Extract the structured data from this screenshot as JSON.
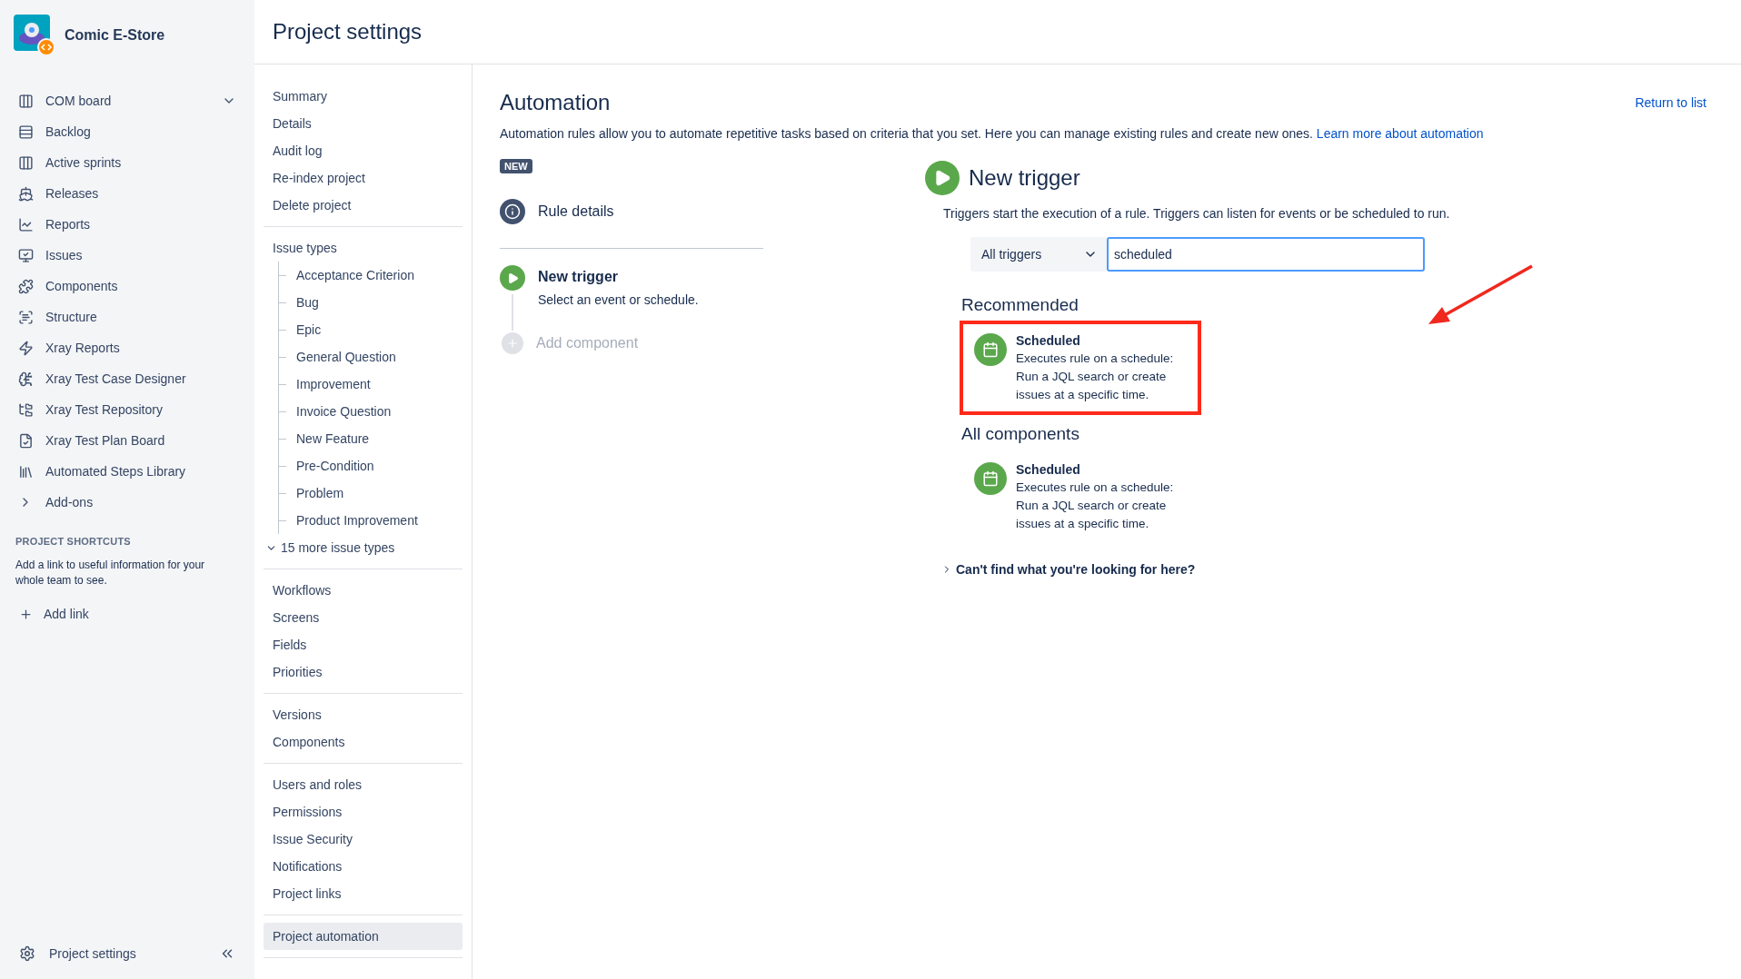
{
  "sidebar": {
    "project_name": "Comic E-Store",
    "items": [
      {
        "label": "COM board",
        "kind": "dropdown"
      },
      {
        "label": "Backlog",
        "kind": "link"
      },
      {
        "label": "Active sprints",
        "kind": "link"
      },
      {
        "label": "Releases",
        "kind": "link"
      },
      {
        "label": "Reports",
        "kind": "link"
      },
      {
        "label": "Issues",
        "kind": "link"
      },
      {
        "label": "Components",
        "kind": "link"
      },
      {
        "label": "Structure",
        "kind": "link"
      },
      {
        "label": "Xray Reports",
        "kind": "link"
      },
      {
        "label": "Xray Test Case Designer",
        "kind": "link"
      },
      {
        "label": "Xray Test Repository",
        "kind": "link"
      },
      {
        "label": "Xray Test Plan Board",
        "kind": "link"
      },
      {
        "label": "Automated Steps Library",
        "kind": "link"
      },
      {
        "label": "Add-ons",
        "kind": "collapsed"
      }
    ],
    "shortcuts": {
      "heading": "PROJECT SHORTCUTS",
      "text": "Add a link to useful information for your whole team to see.",
      "add_label": "Add link"
    },
    "footer": {
      "label": "Project settings"
    }
  },
  "header": {
    "title": "Project settings"
  },
  "settings_nav": {
    "sections": [
      {
        "kind": "links",
        "items": [
          {
            "label": "Summary",
            "selected": false
          },
          {
            "label": "Details",
            "selected": false
          },
          {
            "label": "Audit log",
            "selected": false
          },
          {
            "label": "Re-index project",
            "selected": false
          },
          {
            "label": "Delete project",
            "selected": false
          }
        ]
      },
      {
        "kind": "tree",
        "heading": "Issue types",
        "items": [
          {
            "label": "Acceptance Criterion",
            "selected": false
          },
          {
            "label": "Bug",
            "selected": false
          },
          {
            "label": "Epic",
            "selected": false
          },
          {
            "label": "General Question",
            "selected": false
          },
          {
            "label": "Improvement",
            "selected": false
          },
          {
            "label": "Invoice Question",
            "selected": false
          },
          {
            "label": "New Feature",
            "selected": false
          },
          {
            "label": "Pre-Condition",
            "selected": false
          },
          {
            "label": "Problem",
            "selected": false
          },
          {
            "label": "Product Improvement",
            "selected": false
          }
        ],
        "more": "15 more issue types"
      },
      {
        "kind": "links",
        "items": [
          {
            "label": "Workflows",
            "selected": false
          },
          {
            "label": "Screens",
            "selected": false
          },
          {
            "label": "Fields",
            "selected": false
          },
          {
            "label": "Priorities",
            "selected": false
          }
        ]
      },
      {
        "kind": "links",
        "items": [
          {
            "label": "Versions",
            "selected": false
          },
          {
            "label": "Components",
            "selected": false
          }
        ]
      },
      {
        "kind": "links",
        "items": [
          {
            "label": "Users and roles",
            "selected": false
          },
          {
            "label": "Permissions",
            "selected": false
          },
          {
            "label": "Issue Security",
            "selected": false
          },
          {
            "label": "Notifications",
            "selected": false
          },
          {
            "label": "Project links",
            "selected": false
          }
        ]
      },
      {
        "kind": "links",
        "items": [
          {
            "label": "Project automation",
            "selected": true
          }
        ]
      }
    ]
  },
  "automation": {
    "title": "Automation",
    "return_link": "Return to list",
    "description": "Automation rules allow you to automate repetitive tasks based on criteria that you set. Here you can manage existing rules and create new ones.",
    "learn_more_link": "Learn more about automation",
    "badge": "NEW",
    "steps": [
      {
        "kind": "details",
        "title": "Rule details"
      },
      {
        "kind": "trigger",
        "title": "New trigger",
        "subtitle": "Select an event or schedule."
      },
      {
        "kind": "add",
        "title": "Add component"
      }
    ],
    "trigger_panel": {
      "title": "New trigger",
      "description": "Triggers start the execution of a rule. Triggers can listen for events or be scheduled to run.",
      "filter": {
        "value": "All triggers"
      },
      "search": {
        "value": "scheduled",
        "focused": true
      },
      "sections": [
        {
          "heading": "Recommended",
          "items": [
            {
              "title": "Scheduled",
              "description": "Executes rule on a schedule: Run a JQL search or create issues at a specific time.",
              "highlighted": true
            }
          ]
        },
        {
          "heading": "All components",
          "items": [
            {
              "title": "Scheduled",
              "description": "Executes rule on a schedule: Run a JQL search or create issues at a specific time.",
              "highlighted": false
            }
          ]
        }
      ],
      "help": {
        "label": "Can't find what you're looking for here?"
      }
    }
  }
}
